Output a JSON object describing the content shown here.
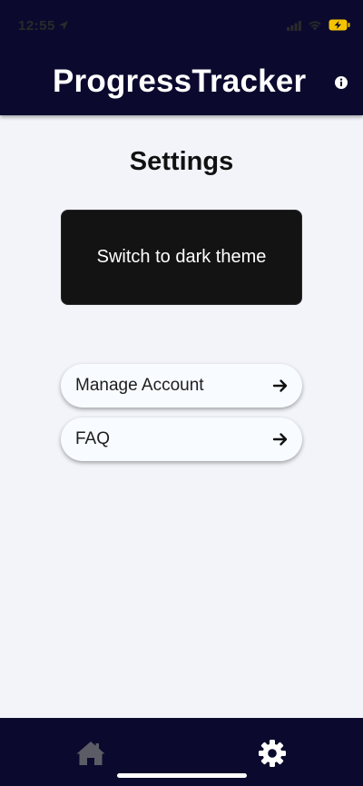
{
  "status_bar": {
    "time": "12:55",
    "icons": [
      "location-arrow-icon",
      "cellular-signal-icon",
      "wifi-icon",
      "battery-charging-icon"
    ],
    "battery_color": "#f5c400"
  },
  "header": {
    "title": "ProgressTracker",
    "info_icon": "info-circle-icon",
    "background": "#0b0a2e"
  },
  "main": {
    "page_title": "Settings",
    "theme_toggle_label": "Switch to dark theme",
    "menu": [
      {
        "label": "Manage Account",
        "icon": "arrow-right-icon"
      },
      {
        "label": "FAQ",
        "icon": "arrow-right-icon"
      }
    ]
  },
  "tabbar": {
    "tabs": [
      {
        "name": "home",
        "icon": "home-icon",
        "active": false,
        "color": "#5c5c66"
      },
      {
        "name": "settings",
        "icon": "gear-icon",
        "active": true,
        "color": "#ffffff"
      }
    ]
  }
}
